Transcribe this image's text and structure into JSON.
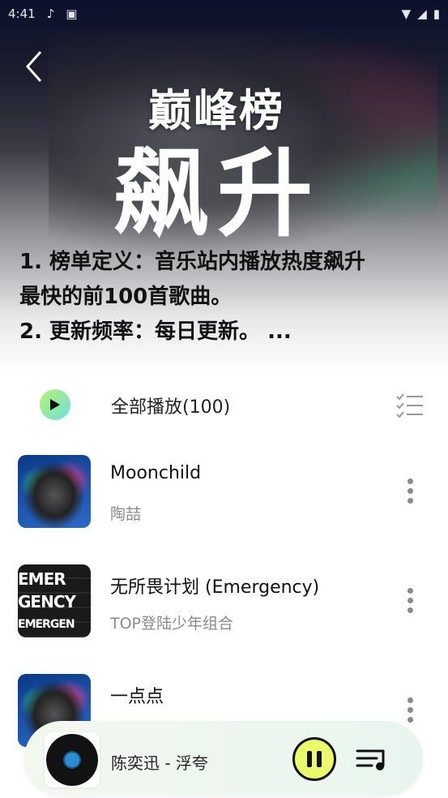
{
  "status_bar": {
    "time": "4:41"
  },
  "header": {
    "logo_text": "巅峰榜",
    "chart_name": "飙升",
    "description": [
      "1. 榜单定义：音乐站内播放热度飙升",
      "最快的前100首歌曲。",
      "2. 更新频率：每日更新。 ..."
    ]
  },
  "play_all": {
    "label": "全部播放(100)"
  },
  "songs": [
    {
      "title": "Moonchild",
      "artist": "陶喆"
    },
    {
      "title": "无所畏计划 (Emergency)",
      "artist": "TOP登陆少年组合",
      "cover_text": [
        "EMER",
        "GENCY",
        "EMERGEN"
      ]
    },
    {
      "title": "一点点",
      "artist": ""
    }
  ],
  "now_playing": {
    "text": "陈奕迅 - 浮夸"
  },
  "colors": {
    "play_accent": "#e9fb6a"
  }
}
